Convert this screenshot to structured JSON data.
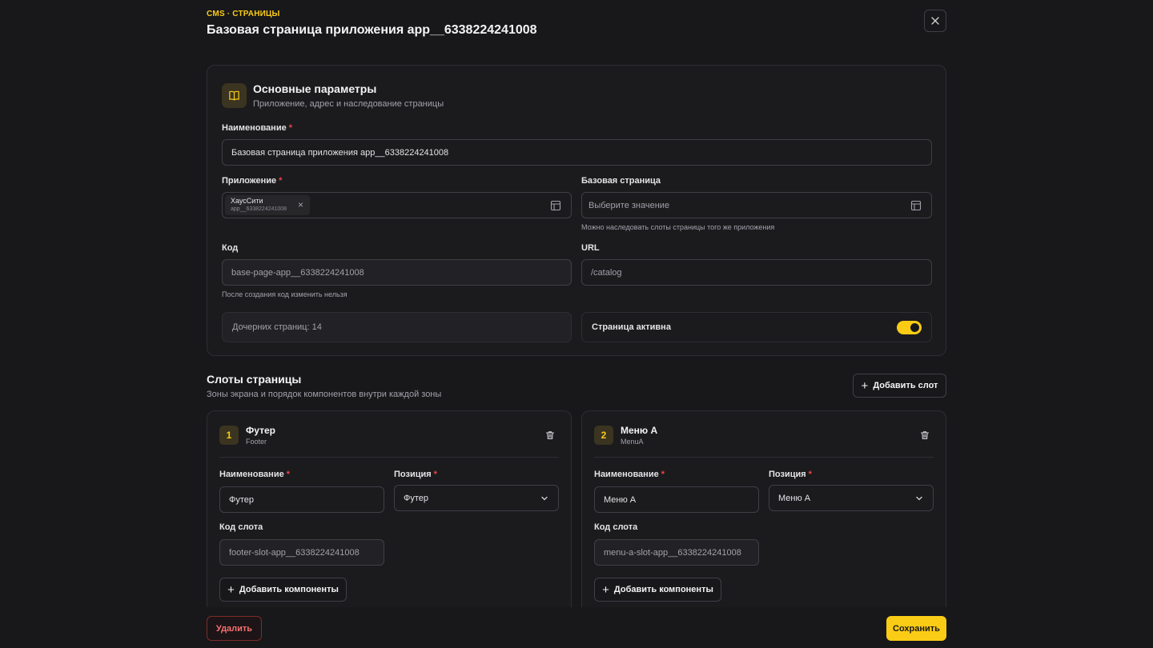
{
  "header": {
    "breadcrumb": "CMS · СТРАНИЦЫ",
    "title": "Базовая страница приложения app__6338224241008"
  },
  "main_section": {
    "title": "Основные параметры",
    "subtitle": "Приложение, адрес и наследование страницы",
    "icon": "book-icon",
    "name_label": "Наименование",
    "name_value": "Базовая страница приложения app__6338224241008",
    "app_label": "Приложение",
    "app_chip_name": "ХаусСити",
    "app_chip_code": "app__6338224241008",
    "base_page_label": "Базовая страница",
    "base_page_placeholder": "Выберите значение",
    "base_page_hint": "Можно наследовать слоты страницы того же приложения",
    "code_label": "Код",
    "code_value": "base-page-app__6338224241008",
    "code_hint": "После создания код изменить нельзя",
    "url_label": "URL",
    "url_placeholder": "/catalog",
    "children_text": "Дочерних страниц: 14",
    "active_label": "Страница активна",
    "active": true
  },
  "slots_section": {
    "title": "Слоты страницы",
    "subtitle": "Зоны экрана и порядок компонентов внутри каждой зоны",
    "add_slot_label": "Добавить слот",
    "slots": [
      {
        "number": "1",
        "name": "Футер",
        "code": "Footer",
        "name_label": "Наименование",
        "name_value": "Футер",
        "position_label": "Позиция",
        "position_value": "Футер",
        "slot_code_label": "Код слота",
        "slot_code_value": "footer-slot-app__6338224241008",
        "add_components_label": "Добавить компоненты"
      },
      {
        "number": "2",
        "name": "Меню А",
        "code": "MenuA",
        "name_label": "Наименование",
        "name_value": "Меню А",
        "position_label": "Позиция",
        "position_value": "Меню А",
        "slot_code_label": "Код слота",
        "slot_code_value": "menu-a-slot-app__6338224241008",
        "add_components_label": "Добавить компоненты"
      }
    ]
  },
  "footer": {
    "delete_label": "Удалить",
    "save_label": "Сохранить"
  },
  "colors": {
    "accent": "#facc15",
    "danger": "#ef4444",
    "background": "#18181b"
  }
}
